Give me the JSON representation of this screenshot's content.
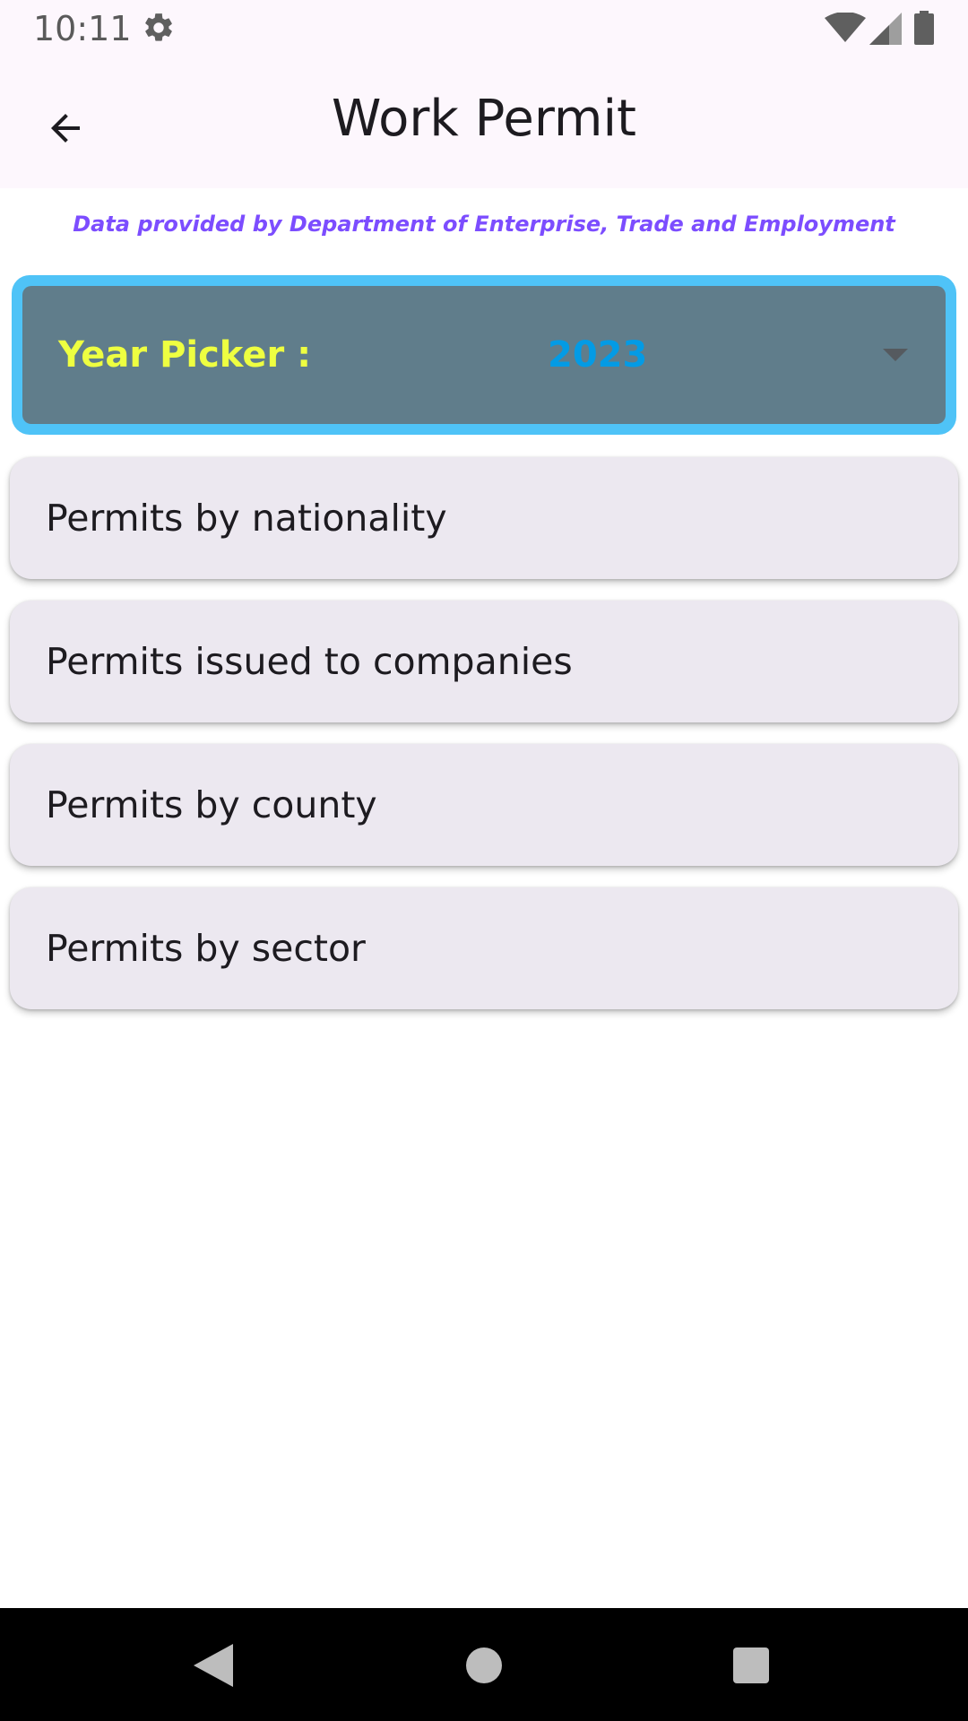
{
  "status_bar": {
    "time": "10:11",
    "icons": [
      "gear-icon",
      "wifi-icon",
      "signal-icon",
      "battery-icon"
    ]
  },
  "app_bar": {
    "title": "Work Permit",
    "back_icon": "arrow-back-icon"
  },
  "attribution": "Data provided by Department of Enterprise, Trade and Employment",
  "year_picker": {
    "label": "Year Picker :",
    "selected_value": "2023",
    "icon": "dropdown-arrow-icon"
  },
  "menu": {
    "items": [
      {
        "label": "Permits by nationality"
      },
      {
        "label": "Permits issued to companies"
      },
      {
        "label": "Permits by county"
      },
      {
        "label": "Permits by sector"
      }
    ]
  },
  "nav_bar": {
    "icons": [
      "nav-back-icon",
      "nav-home-icon",
      "nav-recents-icon"
    ]
  },
  "colors": {
    "app_bar_bg": "#fdf7fd",
    "attribution": "#7c4dff",
    "picker_border": "#4fc3f7",
    "picker_bg": "#607d8b",
    "picker_label": "#eeff41",
    "picker_value": "#039be5",
    "card_bg": "#ece8f0"
  }
}
